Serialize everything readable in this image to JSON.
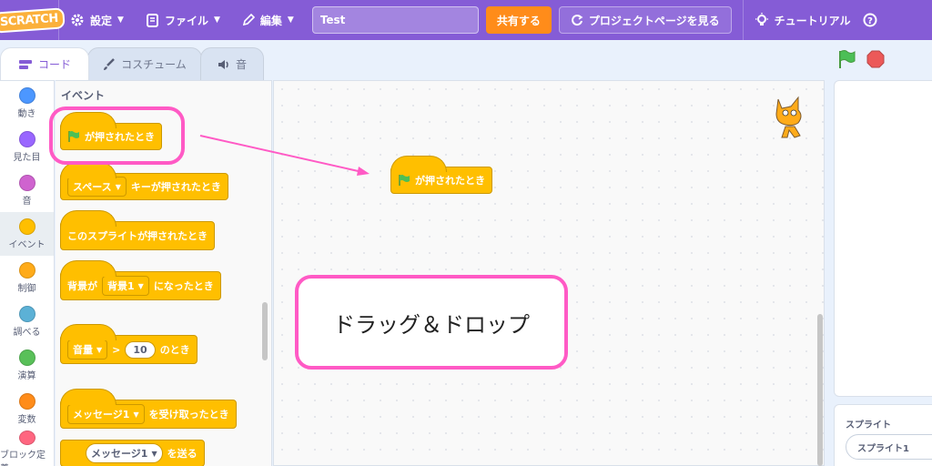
{
  "menubar": {
    "logo": "SCRATCH",
    "settings": "設定",
    "file": "ファイル",
    "edit": "編集",
    "project_title": "Test",
    "share": "共有する",
    "project_page": "プロジェクトページを見る",
    "tutorial": "チュートリアル"
  },
  "tabs": {
    "code": "コード",
    "costumes": "コスチューム",
    "sounds": "音"
  },
  "categories": [
    {
      "label": "動き",
      "color": "#4c97ff"
    },
    {
      "label": "見た目",
      "color": "#9966ff"
    },
    {
      "label": "音",
      "color": "#cf63cf"
    },
    {
      "label": "イベント",
      "color": "#ffbf00"
    },
    {
      "label": "制御",
      "color": "#ffab19"
    },
    {
      "label": "調べる",
      "color": "#5cb1d6"
    },
    {
      "label": "演算",
      "color": "#59c059"
    },
    {
      "label": "変数",
      "color": "#ff8c1a"
    },
    {
      "label": "ブロック定義",
      "color": "#ff6680"
    }
  ],
  "palette": {
    "heading": "イベント",
    "blocks": {
      "flag_clicked": "が押されたとき",
      "key_dropdown": "スペース",
      "key_pressed": "キーが押されたとき",
      "sprite_clicked": "このスプライトが押されたとき",
      "backdrop_prefix": "背景が",
      "backdrop_dropdown": "背景1",
      "backdrop_suffix": "になったとき",
      "volume_dropdown": "音量",
      "volume_op": ">",
      "volume_value": "10",
      "volume_suffix": "のとき",
      "message_dropdown": "メッセージ1",
      "message_received": "を受け取ったとき",
      "broadcast_dropdown": "メッセージ1",
      "broadcast_suffix": "を送る"
    }
  },
  "script_block": "が押されたとき",
  "callout_text": "ドラッグ＆ドロップ",
  "sprite_pane": {
    "label": "スプライト",
    "sprite_name": "スプライト1"
  },
  "colors": {
    "menubar": "#855cd6",
    "event_block": "#ffbf00",
    "highlight": "#ff5ac5",
    "share": "#ff8c1a"
  }
}
